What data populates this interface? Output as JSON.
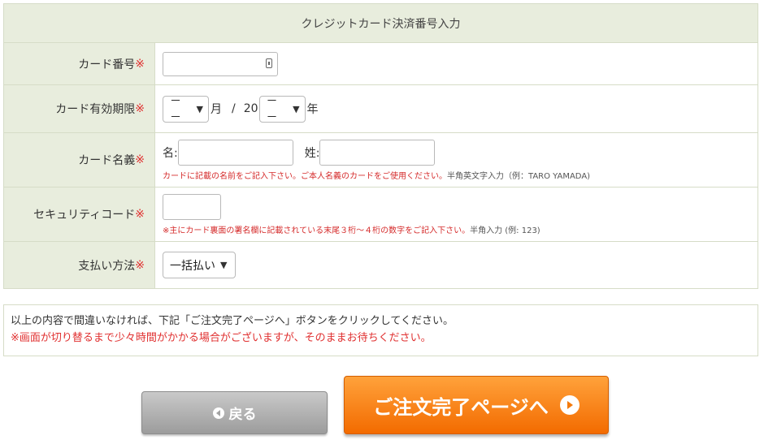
{
  "form": {
    "title": "クレジットカード決済番号入力",
    "required_mark": "※",
    "card_number": {
      "label": "カード番号"
    },
    "expiry": {
      "label": "カード有効期限",
      "month_value": "－－",
      "month_unit": "月",
      "separator": "/",
      "year_prefix": "20",
      "year_value": "－－",
      "year_unit": "年"
    },
    "name": {
      "label": "カード名義",
      "first_label": "名:",
      "last_label": "姓:",
      "note_red": "カードに記載の名前をご記入下さい。ご本人名義のカードをご使用ください。",
      "note_gray": "半角英文字入力（例：TARO YAMADA)"
    },
    "security": {
      "label": "セキュリティコード",
      "note_red": "※主にカード裏面の署名欄に記載されている末尾３桁～４桁の数字をご記入下さい。",
      "note_gray": "半角入力 (例: 123)"
    },
    "payment": {
      "label": "支払い方法",
      "value": "一括払い"
    }
  },
  "message": {
    "line1": "以上の内容で間違いなければ、下記「ご注文完了ページへ」ボタンをクリックしてください。",
    "line2": "※画面が切り替るまで少々時間がかかる場合がございますが、そのままお待ちください。"
  },
  "buttons": {
    "back_label": "戻る",
    "next_label": "ご注文完了ページへ"
  },
  "colors": {
    "header_bg": "#e8eddd",
    "required": "#e03030",
    "next_button": "#f47a0c",
    "back_button": "#a9a9a9"
  }
}
